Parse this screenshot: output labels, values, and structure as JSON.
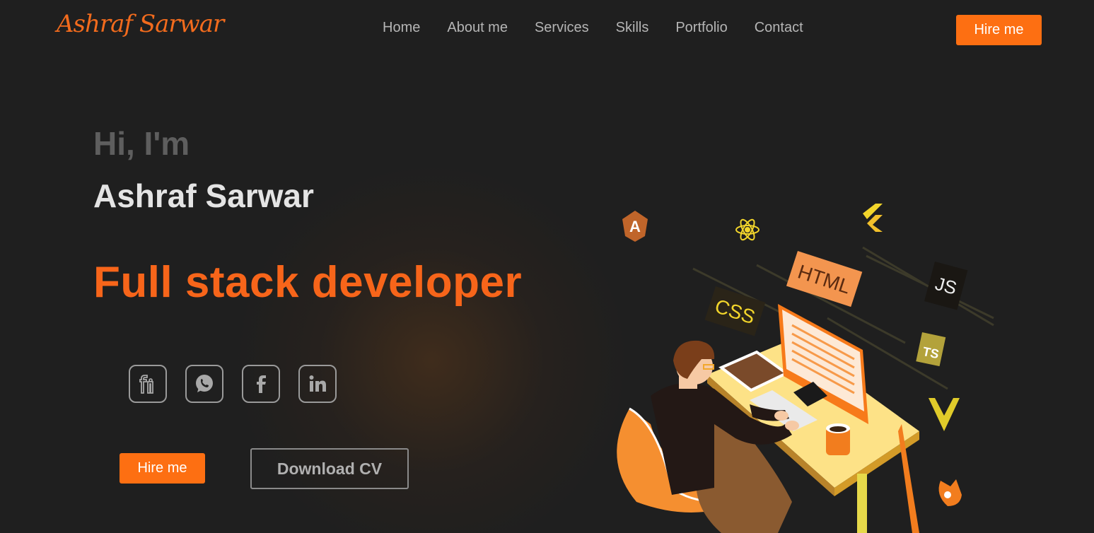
{
  "header": {
    "logo": "Ashraf Sarwar",
    "nav": [
      "Home",
      "About me",
      "Services",
      "Skills",
      "Portfolio",
      "Contact"
    ],
    "hire_label": "Hire me"
  },
  "hero": {
    "greeting": "Hi, I'm",
    "name": "Ashraf Sarwar",
    "role": "Full stack developer",
    "socials": [
      "fiverr-icon",
      "whatsapp-icon",
      "facebook-icon",
      "linkedin-icon"
    ],
    "hire_label": "Hire me",
    "cv_label": "Download CV"
  },
  "illustration": {
    "tags": [
      "HTML",
      "CSS",
      "JS",
      "TS"
    ]
  },
  "colors": {
    "accent": "#fd6f12",
    "background": "#1f1f1f"
  }
}
